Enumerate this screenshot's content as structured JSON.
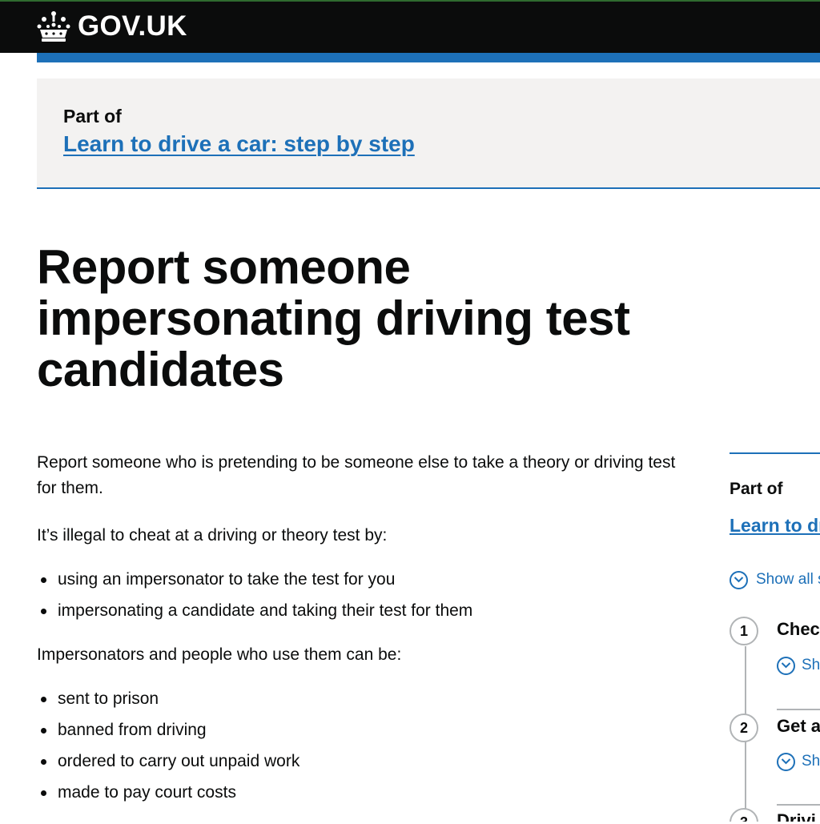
{
  "header": {
    "logo_text": "GOV.UK",
    "logo_icon": "crown-icon"
  },
  "breadcrumb": {
    "part_of": "Part of",
    "link": "Learn to drive a car: step by step"
  },
  "page": {
    "title": "Report someone impersonating driving test candidates",
    "intro": "Report someone who is pretending to be someone else to take a theory or driving test for them.",
    "illegal_heading": "It’s illegal to cheat at a driving or theory test by:",
    "illegal_items": [
      "using an impersonator to take the test for you",
      "impersonating a candidate and taking their test for them"
    ],
    "consequences_heading": "Impersonators and people who use them can be:",
    "consequences_items": [
      "sent to prison",
      "banned from driving",
      "ordered to carry out unpaid work",
      "made to pay court costs"
    ]
  },
  "sidebar": {
    "part_of": "Part of",
    "link": "Learn to dr",
    "show_all": "Show all s",
    "steps": [
      {
        "number": "1",
        "title": "Chec",
        "show": "Sh"
      },
      {
        "number": "2",
        "title": "Get a",
        "show": "Sh"
      },
      {
        "number": "3",
        "title": "Drivi"
      }
    ]
  },
  "colors": {
    "link": "#1d70b8",
    "header_bg": "#0b0c0c",
    "text": "#0b0c0c",
    "panel_bg": "#f3f2f1"
  }
}
